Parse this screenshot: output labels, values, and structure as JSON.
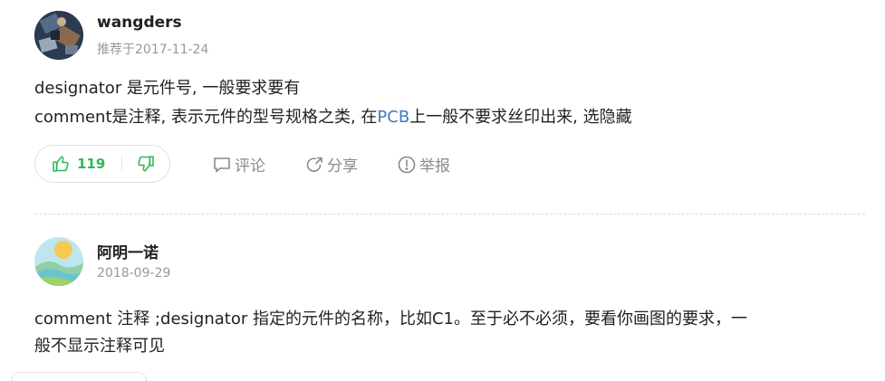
{
  "answers": [
    {
      "username": "wangders",
      "meta": "推荐于2017-11-24",
      "content_lines": [
        "designator 是元件号, 一般要求要有",
        "comment是注释, 表示元件的型号规格之类, 在",
        "PCB",
        "上一般不要求丝印出来, 选隐藏"
      ],
      "votes": "119",
      "actions": {
        "comment": "评论",
        "share": "分享",
        "report": "举报"
      }
    },
    {
      "username": "阿明一诺",
      "meta": "2018-09-29",
      "content_lines": [
        "comment 注释 ;designator 指定的元件的名称，比如C1。至于必不必须，要看你画图的要求，一",
        "般不显示注释可见"
      ]
    }
  ],
  "colors": {
    "link": "#3c7bc0",
    "upvote": "#2fb95a",
    "muted": "#999999"
  }
}
